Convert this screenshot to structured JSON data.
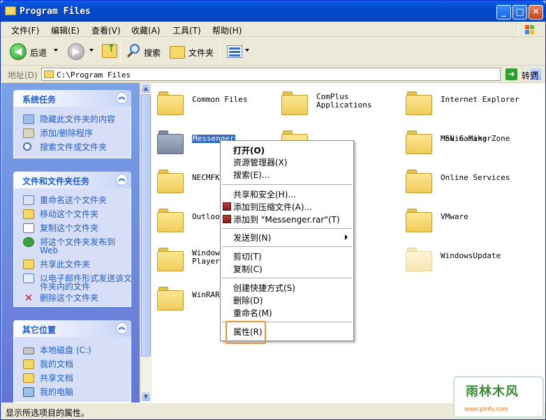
{
  "window": {
    "title": "Program Files"
  },
  "menubar": {
    "items": [
      "文件(F)",
      "编辑(E)",
      "查看(V)",
      "收藏(A)",
      "工具(T)",
      "帮助(H)"
    ]
  },
  "toolbar": {
    "back": "后退",
    "search": "搜索",
    "folders": "文件夹"
  },
  "address": {
    "label": "地址(D)",
    "value": "C:\\Program Files",
    "go": "转到"
  },
  "panels": {
    "system": {
      "title": "系统任务",
      "items": [
        "隐藏此文件夹的内容",
        "添加/删除程序",
        "搜索文件或文件夹"
      ]
    },
    "filetasks": {
      "title": "文件和文件夹任务",
      "items": [
        "重命名这个文件夹",
        "移动这个文件夹",
        "复制这个文件夹",
        "将这个文件夹发布到 Web",
        "共享此文件夹",
        "以电子邮件形式发送该文件夹内的文件",
        "删除这个文件夹"
      ]
    },
    "other": {
      "title": "其它位置",
      "items": [
        "本地磁盘 (C:)",
        "我的文档",
        "共享文档",
        "我的电脑"
      ]
    }
  },
  "files": [
    {
      "name": "Common Files"
    },
    {
      "name": "ComPlus\nApplications"
    },
    {
      "name": "Internet Explorer"
    },
    {
      "name": "Messenger"
    },
    {
      "name": "Movie Maker"
    },
    {
      "name": "MSN Gaming Zone"
    },
    {
      "name": "NECMFK"
    },
    {
      "name": "Online Services"
    },
    {
      "name": "Outlook"
    },
    {
      "name": "VMware"
    },
    {
      "name": "Windows\nPlayer"
    },
    {
      "name": "WindowsUpdate"
    },
    {
      "name": "WinRAR"
    }
  ],
  "context_menu": {
    "open": "打开(O)",
    "explorer": "资源管理器(X)",
    "search": "搜索(E)...",
    "share": "共享和安全(H)...",
    "add_archive": "添加到压缩文件(A)...",
    "add_rar": "添加到 \"Messenger.rar\"(T)",
    "sendto": "发送到(N)",
    "cut": "剪切(T)",
    "copy": "复制(C)",
    "shortcut": "创建快捷方式(S)",
    "delete": "删除(D)",
    "rename": "重命名(M)",
    "properties": "属性(R)"
  },
  "status": {
    "text": "显示所选项目的属性。"
  },
  "watermark": {
    "line1": "雨林木风",
    "line2": "www.ylmfu.com"
  }
}
